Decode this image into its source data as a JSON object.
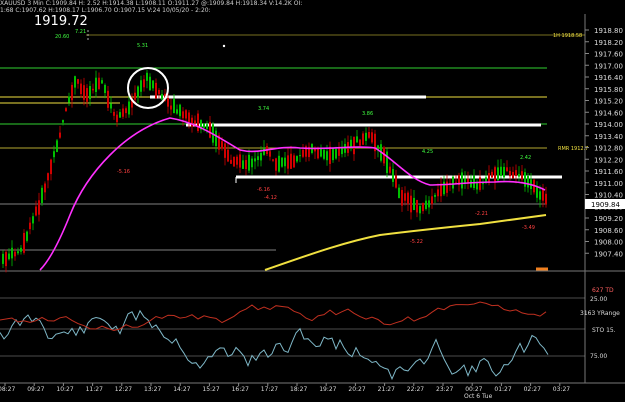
{
  "header": {
    "line1": "XAUUSD 3 Min  C:1909.84  H:  2.52  H:1914.38  L:1908.11  O:1911.27  @:1909.84  H:1918.34  V:14.2K  OI:",
    "line2": "1:68  C:1907.62  H:1908.17  L:1906.70  O:1907.15  V:24  10/05/20 - 2:20:"
  },
  "chart": {
    "big_price": "1919.72",
    "current_price": "1909.84",
    "colors": {
      "up": "#00c000",
      "down": "#d00000",
      "ma_fast": "#ff30ff",
      "ma_slow": "#f0e040",
      "green_line": "#30d030",
      "white_line": "#ffffff",
      "price_box": "#ffffff"
    },
    "price_axis": [
      "1918.80",
      "1918.20",
      "1917.60",
      "1917.00",
      "1916.40",
      "1915.80",
      "1915.20",
      "1914.60",
      "1914.00",
      "1913.40",
      "1912.80",
      "1912.20",
      "1911.60",
      "1911.00",
      "1910.40",
      "1909.80",
      "1909.20",
      "1908.60",
      "1908.00",
      "1907.40"
    ],
    "time_axis": [
      "08:27",
      "09:27",
      "10:27",
      "11:27",
      "12:27",
      "13:27",
      "14:27",
      "15:27",
      "16:27",
      "17:27",
      "18:27",
      "19:27",
      "20:27",
      "21:27",
      "22:27",
      "23:27",
      "00:27",
      "01:27",
      "02:27",
      "03:27"
    ],
    "date_label": "Oct 6 Tue",
    "level_labels": {
      "top": "1H 1918.58",
      "rmr": "RMR 1912.7"
    },
    "annotations": [
      {
        "text": "20.60",
        "color": "#40ff40"
      },
      {
        "text": "7.21",
        "color": "#40ff40"
      },
      {
        "text": "5.31",
        "color": "#40ff40"
      },
      {
        "text": "3.74",
        "color": "#40ff40"
      },
      {
        "text": "3.86",
        "color": "#40ff40"
      },
      {
        "text": "4.25",
        "color": "#40ff40"
      },
      {
        "text": "2.42",
        "color": "#40ff40"
      },
      {
        "text": "-5.16",
        "color": "#ff4040"
      },
      {
        "text": "-6.16",
        "color": "#ff4040"
      },
      {
        "text": "-4.12",
        "color": "#ff4040"
      },
      {
        "text": "-5.22",
        "color": "#ff4040"
      },
      {
        "text": "-2.21",
        "color": "#ff4040"
      },
      {
        "text": "-3.49",
        "color": "#ff4040"
      }
    ]
  },
  "indicator": {
    "td_label": "627 TD",
    "yrange_label": "3163 YRange",
    "sto_label": "STO  15.",
    "level_high": "25.00",
    "level_low": "75.00"
  }
}
